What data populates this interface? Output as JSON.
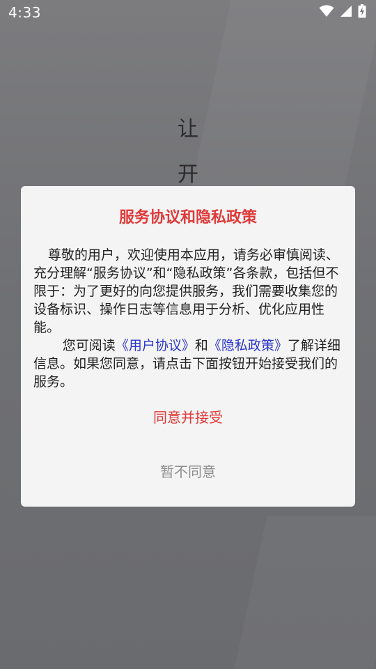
{
  "status_bar": {
    "time": "4:33",
    "icons": [
      "wifi-icon",
      "signal-icon",
      "battery-charging-icon"
    ]
  },
  "background": {
    "chars": [
      "让",
      "开"
    ]
  },
  "dialog": {
    "title": "服务协议和隐私政策",
    "para1": "尊敬的用户，欢迎使用本应用，请务必审慎阅读、充分理解“服务协议”和“隐私政策”各条款，包括但不限于：为了更好的向您提供服务，我们需要收集您的设备标识、操作日志等信息用于分析、优化应用性能。",
    "para2_prefix": "您可阅读",
    "user_agreement_link": "《用户协议》",
    "para2_and": "和",
    "privacy_policy_link": "《隐私政策》",
    "para2_suffix": "了解详细信息。如果您同意，请点击下面按钮开始接受我们的服务。",
    "agree_button": "同意并接受",
    "decline_button": "暂不同意"
  },
  "colors": {
    "title_red": "#e03a3a",
    "link_blue": "#2a36c8",
    "decline_gray": "#8e8e8e",
    "dialog_bg": "#f4f4f4"
  }
}
